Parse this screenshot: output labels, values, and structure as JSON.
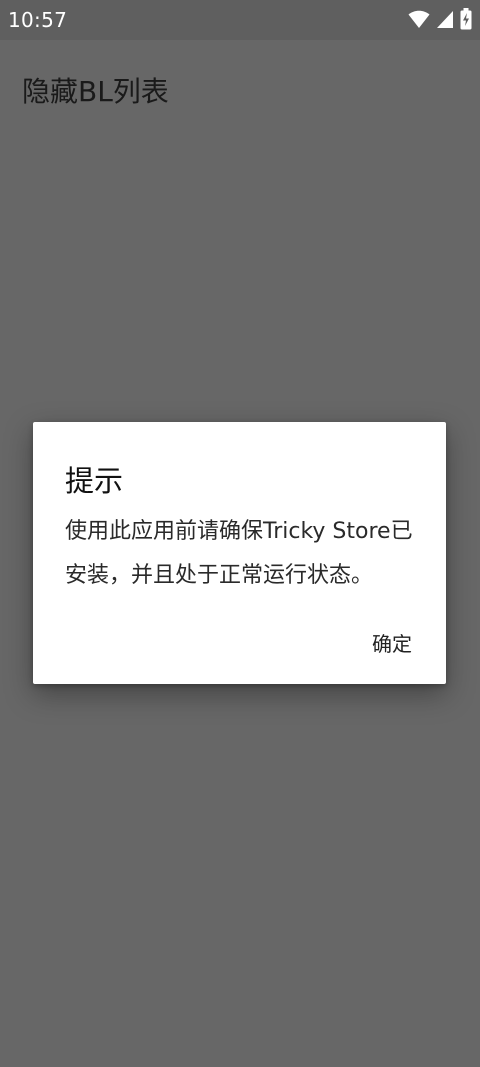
{
  "status_bar": {
    "time": "10:57",
    "icons": [
      "wifi-icon",
      "cellular-signal-icon",
      "battery-charging-icon"
    ]
  },
  "app_bar": {
    "title": "隐藏BL列表"
  },
  "dialog": {
    "title": "提示",
    "message": "使用此应用前请确保Tricky Store已安装，并且处于正常运行状态。",
    "confirm_label": "确定"
  },
  "colors": {
    "scrim_background": "#676767",
    "status_bar": "#5f5f5f",
    "dialog_surface": "#ffffff",
    "status_text": "#ffffff"
  }
}
